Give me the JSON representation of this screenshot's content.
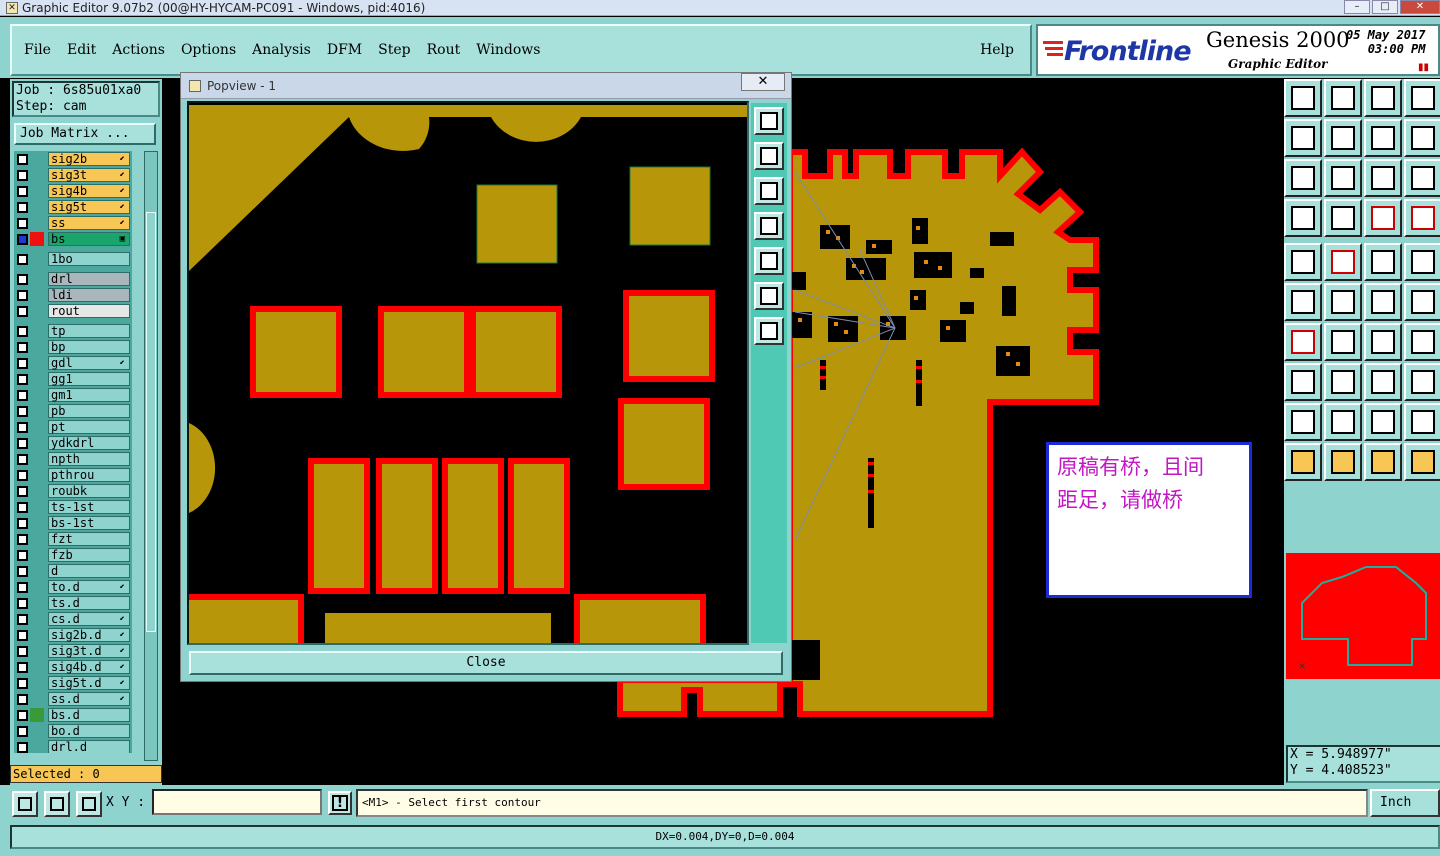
{
  "window": {
    "title": "Graphic Editor 9.07b2 (00@HY-HYCAM-PC091 - Windows, pid:4016)",
    "minimize": "–",
    "maximize": "□",
    "close": "✕"
  },
  "menu": {
    "items": [
      "File",
      "Edit",
      "Actions",
      "Options",
      "Analysis",
      "DFM",
      "Step",
      "Rout",
      "Windows"
    ],
    "help": "Help"
  },
  "brand": {
    "logo": "Frontline",
    "product": "Genesis 2000",
    "subtitle": "Graphic Editor",
    "date": "05 May 2017",
    "time": "03:00 PM",
    "pause_glyph": "▮▮"
  },
  "job": {
    "job_line": "Job  : 6s85u01xa0",
    "step_line": "Step: cam",
    "job_matrix": "Job Matrix ..."
  },
  "layers": [
    {
      "name": "sig2b",
      "color": "#f7c654",
      "mark": "⬋"
    },
    {
      "name": "sig3t",
      "color": "#f7c654",
      "mark": "⬋"
    },
    {
      "name": "sig4b",
      "color": "#f7c654",
      "mark": "⬋"
    },
    {
      "name": "sig5t",
      "color": "#f7c654",
      "mark": "⬋"
    },
    {
      "name": "ss",
      "color": "#f7c654",
      "mark": "⬋"
    },
    {
      "name": "bs",
      "color": "#1aa56d",
      "mark": "▣",
      "active": true
    },
    {
      "gap": true
    },
    {
      "name": "1bo",
      "color": "#8fd3cf",
      "mark": ""
    },
    {
      "gap": true
    },
    {
      "name": "drl",
      "color": "#a9b7bd",
      "mark": ""
    },
    {
      "name": "ldi",
      "color": "#a9b7bd",
      "mark": ""
    },
    {
      "name": "rout",
      "color": "#e7e7e7",
      "mark": ""
    },
    {
      "gap": true
    },
    {
      "name": "tp",
      "color": "#8fd3cf",
      "mark": ""
    },
    {
      "name": "bp",
      "color": "#8fd3cf",
      "mark": ""
    },
    {
      "name": "gdl",
      "color": "#8fd3cf",
      "mark": "⬋"
    },
    {
      "name": "gg1",
      "color": "#8fd3cf",
      "mark": ""
    },
    {
      "name": "gm1",
      "color": "#8fd3cf",
      "mark": ""
    },
    {
      "name": "pb",
      "color": "#8fd3cf",
      "mark": ""
    },
    {
      "name": "pt",
      "color": "#8fd3cf",
      "mark": ""
    },
    {
      "name": "ydkdrl",
      "color": "#8fd3cf",
      "mark": ""
    },
    {
      "name": "npth",
      "color": "#8fd3cf",
      "mark": ""
    },
    {
      "name": "pthrou",
      "color": "#8fd3cf",
      "mark": ""
    },
    {
      "name": "roubk",
      "color": "#8fd3cf",
      "mark": ""
    },
    {
      "name": "ts-1st",
      "color": "#8fd3cf",
      "mark": ""
    },
    {
      "name": "bs-1st",
      "color": "#8fd3cf",
      "mark": ""
    },
    {
      "name": "fzt",
      "color": "#8fd3cf",
      "mark": ""
    },
    {
      "name": "fzb",
      "color": "#8fd3cf",
      "mark": ""
    },
    {
      "name": "d",
      "color": "#8fd3cf",
      "mark": ""
    },
    {
      "name": "to.d",
      "color": "#8fd3cf",
      "mark": "⬋"
    },
    {
      "name": "ts.d",
      "color": "#8fd3cf",
      "mark": ""
    },
    {
      "name": "cs.d",
      "color": "#8fd3cf",
      "mark": "⬋"
    },
    {
      "name": "sig2b.d",
      "color": "#8fd3cf",
      "mark": "⬋"
    },
    {
      "name": "sig3t.d",
      "color": "#8fd3cf",
      "mark": "⬋"
    },
    {
      "name": "sig4b.d",
      "color": "#8fd3cf",
      "mark": "⬋"
    },
    {
      "name": "sig5t.d",
      "color": "#8fd3cf",
      "mark": "⬋"
    },
    {
      "name": "ss.d",
      "color": "#8fd3cf",
      "mark": "⬋"
    },
    {
      "name": "bs.d",
      "color": "#8fd3cf",
      "mark": "",
      "swatch": "#3a9a3a"
    },
    {
      "name": "bo.d",
      "color": "#8fd3cf",
      "mark": ""
    },
    {
      "name": "drl.d",
      "color": "#8fd3cf",
      "mark": ""
    }
  ],
  "selected": "Selected : 0",
  "popview": {
    "title": "Popview - 1",
    "close_x": "✕",
    "close_button": "Close"
  },
  "note": {
    "line1": "原稿有桥，且间",
    "line2": "距足，请做桥"
  },
  "coords": {
    "x": "X = 5.948977\"",
    "y": "Y = 4.408523\""
  },
  "bottom": {
    "xy_label": "X Y :",
    "xy_value": "",
    "bang": "!",
    "prompt": "<M1> - Select first contour",
    "units": "Inch",
    "status": "DX=0.004,DY=0,D=0.004"
  },
  "colors": {
    "copper": "#b8960a",
    "outline": "#ff0000",
    "panel": "#8fd3cf",
    "note_text": "#c317c5"
  }
}
